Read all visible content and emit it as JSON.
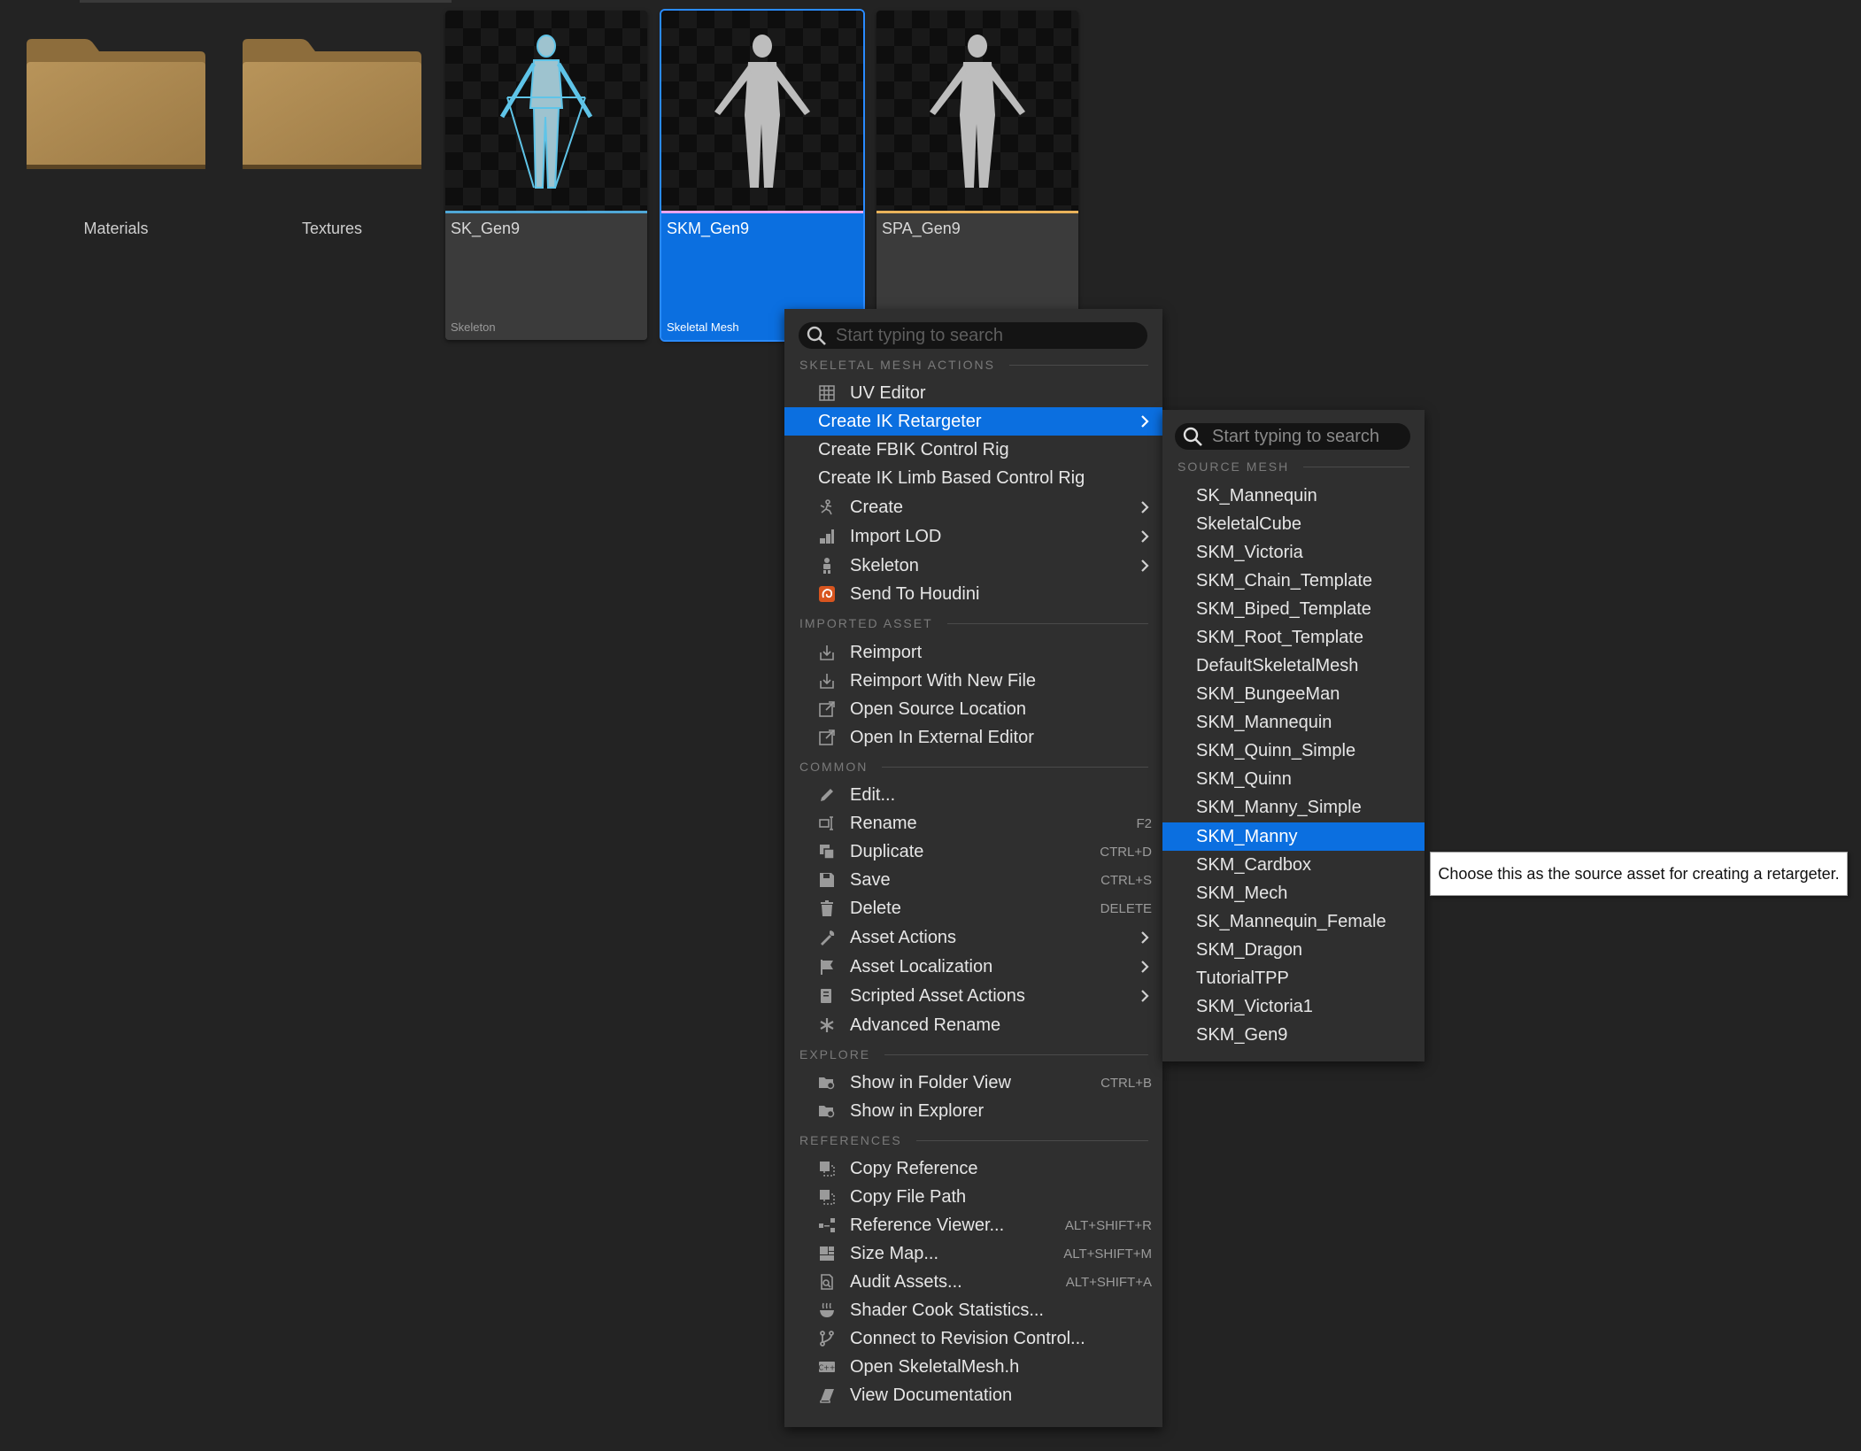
{
  "folders": [
    {
      "label": "Materials"
    },
    {
      "label": "Textures"
    }
  ],
  "assets": [
    {
      "name": "SK_Gen9",
      "type": "Skeleton",
      "stripe_color": "#4fa7d6"
    },
    {
      "name": "SKM_Gen9",
      "type": "Skeletal Mesh",
      "stripe_color": "#e9a4f0",
      "selected": true
    },
    {
      "name": "SPA_Gen9",
      "type": "",
      "stripe_color": "#e9b25a"
    }
  ],
  "context_menu": {
    "search_placeholder": "Start typing to search",
    "sections": {
      "skeletal_mesh_actions": "SKELETAL MESH ACTIONS",
      "imported_asset": "IMPORTED ASSET",
      "common": "COMMON",
      "explore": "EXPLORE",
      "references": "REFERENCES"
    },
    "items": {
      "uv_editor": "UV Editor",
      "create_ik_retargeter": "Create IK Retargeter",
      "create_fbik_control_rig": "Create FBIK Control Rig",
      "create_ik_limb": "Create IK Limb Based Control Rig",
      "create": "Create",
      "import_lod": "Import LOD",
      "skeleton": "Skeleton",
      "send_to_houdini": "Send To Houdini",
      "reimport": "Reimport",
      "reimport_new_file": "Reimport With New File",
      "open_source_location": "Open Source Location",
      "open_external_editor": "Open In External Editor",
      "edit": "Edit...",
      "rename": "Rename",
      "duplicate": "Duplicate",
      "save": "Save",
      "delete": "Delete",
      "asset_actions": "Asset Actions",
      "asset_localization": "Asset Localization",
      "scripted_asset_actions": "Scripted Asset Actions",
      "advanced_rename": "Advanced Rename",
      "show_folder_view": "Show in Folder View",
      "show_explorer": "Show in Explorer",
      "copy_reference": "Copy Reference",
      "copy_file_path": "Copy File Path",
      "reference_viewer": "Reference Viewer...",
      "size_map": "Size Map...",
      "audit_assets": "Audit Assets...",
      "shader_cook_stats": "Shader Cook Statistics...",
      "connect_revision": "Connect to Revision Control...",
      "open_skeletalmesh_h": "Open SkeletalMesh.h",
      "view_documentation": "View Documentation"
    },
    "shortcuts": {
      "rename": "F2",
      "duplicate": "CTRL+D",
      "save": "CTRL+S",
      "delete": "DELETE",
      "show_folder_view": "CTRL+B",
      "reference_viewer": "ALT+SHIFT+R",
      "size_map": "ALT+SHIFT+M",
      "audit_assets": "ALT+SHIFT+A"
    }
  },
  "submenu": {
    "search_placeholder": "Start typing to search",
    "section": "SOURCE MESH",
    "items": [
      "SK_Mannequin",
      "SkeletalCube",
      "SKM_Victoria",
      "SKM_Chain_Template",
      "SKM_Biped_Template",
      "SKM_Root_Template",
      "DefaultSkeletalMesh",
      "SKM_BungeeMan",
      "SKM_Mannequin",
      "SKM_Quinn_Simple",
      "SKM_Quinn",
      "SKM_Manny_Simple",
      "SKM_Manny",
      "SKM_Cardbox",
      "SKM_Mech",
      "SK_Mannequin_Female",
      "SKM_Dragon",
      "TutorialTPP",
      "SKM_Victoria1",
      "SKM_Gen9"
    ],
    "highlighted": "SKM_Manny"
  },
  "tooltip": {
    "text": "Choose this as the source asset for creating a retargeter."
  },
  "colors": {
    "highlight": "#0b6fe0",
    "menu_bg": "#2f2f2f",
    "background": "#232323"
  }
}
